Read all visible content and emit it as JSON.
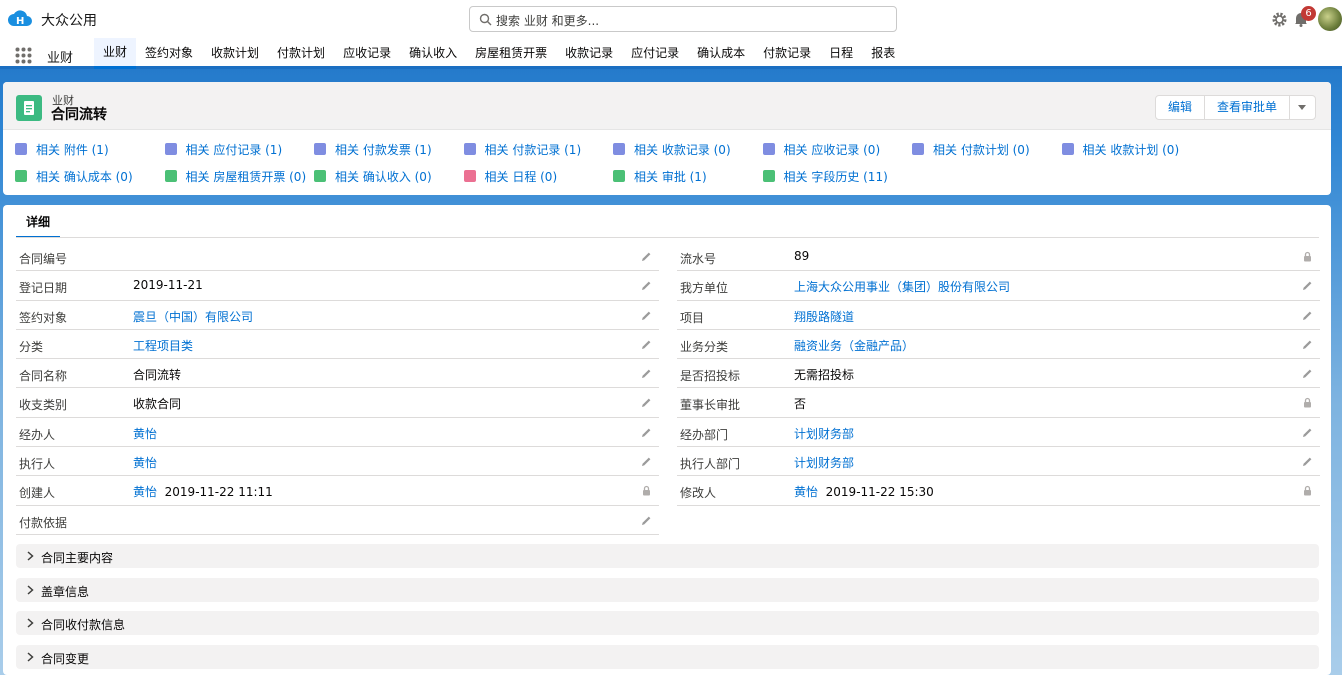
{
  "app": {
    "name": "大众公用",
    "search_placeholder": "搜索 业财 和更多...",
    "notifications": "6"
  },
  "nav": {
    "app_label": "业财",
    "tabs": [
      "业财",
      "签约对象",
      "收款计划",
      "付款计划",
      "应收记录",
      "确认收入",
      "房屋租赁开票",
      "收款记录",
      "应付记录",
      "确认成本",
      "付款记录",
      "日程",
      "报表"
    ]
  },
  "record": {
    "type": "业财",
    "title": "合同流转",
    "buttons": {
      "edit": "编辑",
      "view_approval": "查看审批单"
    },
    "related": [
      {
        "label": "相关 附件 (1)",
        "icon": "attachment-icon",
        "color": "#7f8de1"
      },
      {
        "label": "相关 应付记录 (1)",
        "icon": "record-icon",
        "color": "#7f8de1"
      },
      {
        "label": "相关 付款发票 (1)",
        "icon": "record-icon",
        "color": "#7f8de1"
      },
      {
        "label": "相关 付款记录 (1)",
        "icon": "record-icon",
        "color": "#7f8de1"
      },
      {
        "label": "相关 收款记录 (0)",
        "icon": "record-icon",
        "color": "#7f8de1"
      },
      {
        "label": "相关 应收记录 (0)",
        "icon": "record-icon",
        "color": "#7f8de1"
      },
      {
        "label": "相关 付款计划 (0)",
        "icon": "stack-icon",
        "color": "#7f8de1"
      },
      {
        "label": "相关 收款计划 (0)",
        "icon": "stack-icon",
        "color": "#7f8de1"
      },
      {
        "label": "相关 确认成本 (0)",
        "icon": "clipboard-icon",
        "color": "#4bc076"
      },
      {
        "label": "相关 房屋租赁开票 (0)",
        "icon": "clipboard-icon",
        "color": "#4bc076"
      },
      {
        "label": "相关 确认收入 (0)",
        "icon": "clipboard-icon",
        "color": "#4bc076"
      },
      {
        "label": "相关 日程 (0)",
        "icon": "calendar-icon",
        "color": "#eb7092"
      },
      {
        "label": "相关 审批 (1)",
        "icon": "approval-icon",
        "color": "#4bc076"
      },
      {
        "label": "相关 字段历史 (11)",
        "icon": "clipboard-icon",
        "color": "#4bc076"
      }
    ]
  },
  "detail": {
    "tab": "详细",
    "left": [
      {
        "label": "合同编号",
        "value": "",
        "link": false,
        "lock": false
      },
      {
        "label": "登记日期",
        "value": "2019-11-21",
        "link": false,
        "lock": false
      },
      {
        "label": "签约对象",
        "value": "震旦（中国）有限公司",
        "link": true,
        "lock": false
      },
      {
        "label": "分类",
        "value": "工程项目类",
        "link": true,
        "lock": false
      },
      {
        "label": "合同名称",
        "value": "合同流转",
        "link": false,
        "lock": false
      },
      {
        "label": "收支类别",
        "value": "收款合同",
        "link": false,
        "lock": false
      },
      {
        "label": "经办人",
        "value": "黄怡",
        "link": true,
        "lock": false
      },
      {
        "label": "执行人",
        "value": "黄怡",
        "link": true,
        "lock": false
      },
      {
        "label": "创建人",
        "value": "黄怡",
        "extra": "2019-11-22 11:11",
        "link": true,
        "lock": true
      },
      {
        "label": "付款依据",
        "value": "",
        "link": false,
        "lock": false
      }
    ],
    "right": [
      {
        "label": "流水号",
        "value": "89",
        "link": false,
        "lock": true
      },
      {
        "label": "我方单位",
        "value": "上海大众公用事业（集团）股份有限公司",
        "link": true,
        "lock": false
      },
      {
        "label": "项目",
        "value": "翔殷路隧道",
        "link": true,
        "lock": false
      },
      {
        "label": "业务分类",
        "value": "融资业务（金融产品）",
        "link": true,
        "lock": false
      },
      {
        "label": "是否招投标",
        "value": "无需招投标",
        "link": false,
        "lock": false
      },
      {
        "label": "董事长审批",
        "value": "否",
        "link": false,
        "lock": true
      },
      {
        "label": "经办部门",
        "value": "计划财务部",
        "link": true,
        "lock": false
      },
      {
        "label": "执行人部门",
        "value": "计划财务部",
        "link": true,
        "lock": false
      },
      {
        "label": "修改人",
        "value": "黄怡",
        "extra": "2019-11-22 15:30",
        "link": true,
        "lock": true
      }
    ],
    "sections": [
      "合同主要内容",
      "盖章信息",
      "合同收付款信息",
      "合同变更"
    ]
  }
}
